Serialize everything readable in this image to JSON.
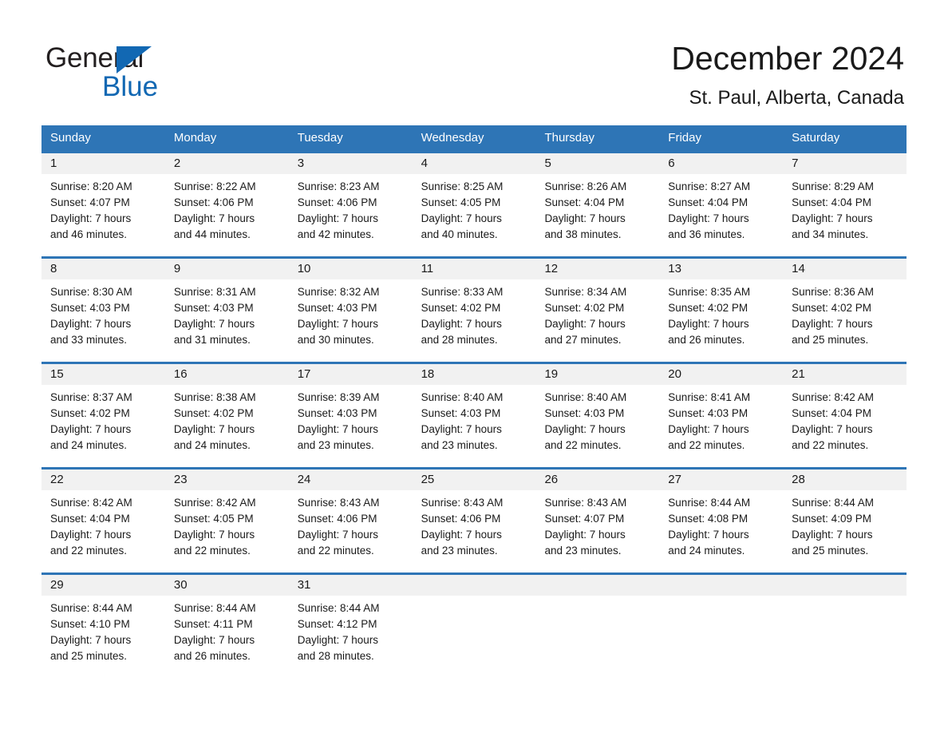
{
  "logo": {
    "word_one": "General",
    "word_two": "Blue",
    "triangle_icon": "triangle-icon",
    "brand_color": "#1268b3"
  },
  "header": {
    "title": "December 2024",
    "subtitle": "St. Paul, Alberta, Canada"
  },
  "theme": {
    "header_blue": "#2e75b6",
    "row_divider_blue": "#2e75b6",
    "date_band_gray": "#f1f1f1",
    "text_color": "#1a1a1a"
  },
  "weekdays": [
    "Sunday",
    "Monday",
    "Tuesday",
    "Wednesday",
    "Thursday",
    "Friday",
    "Saturday"
  ],
  "weeks": [
    {
      "days": [
        {
          "date": "1",
          "sunrise": "Sunrise: 8:20 AM",
          "sunset": "Sunset: 4:07 PM",
          "daylight_line1": "Daylight: 7 hours",
          "daylight_line2": "and 46 minutes."
        },
        {
          "date": "2",
          "sunrise": "Sunrise: 8:22 AM",
          "sunset": "Sunset: 4:06 PM",
          "daylight_line1": "Daylight: 7 hours",
          "daylight_line2": "and 44 minutes."
        },
        {
          "date": "3",
          "sunrise": "Sunrise: 8:23 AM",
          "sunset": "Sunset: 4:06 PM",
          "daylight_line1": "Daylight: 7 hours",
          "daylight_line2": "and 42 minutes."
        },
        {
          "date": "4",
          "sunrise": "Sunrise: 8:25 AM",
          "sunset": "Sunset: 4:05 PM",
          "daylight_line1": "Daylight: 7 hours",
          "daylight_line2": "and 40 minutes."
        },
        {
          "date": "5",
          "sunrise": "Sunrise: 8:26 AM",
          "sunset": "Sunset: 4:04 PM",
          "daylight_line1": "Daylight: 7 hours",
          "daylight_line2": "and 38 minutes."
        },
        {
          "date": "6",
          "sunrise": "Sunrise: 8:27 AM",
          "sunset": "Sunset: 4:04 PM",
          "daylight_line1": "Daylight: 7 hours",
          "daylight_line2": "and 36 minutes."
        },
        {
          "date": "7",
          "sunrise": "Sunrise: 8:29 AM",
          "sunset": "Sunset: 4:04 PM",
          "daylight_line1": "Daylight: 7 hours",
          "daylight_line2": "and 34 minutes."
        }
      ]
    },
    {
      "days": [
        {
          "date": "8",
          "sunrise": "Sunrise: 8:30 AM",
          "sunset": "Sunset: 4:03 PM",
          "daylight_line1": "Daylight: 7 hours",
          "daylight_line2": "and 33 minutes."
        },
        {
          "date": "9",
          "sunrise": "Sunrise: 8:31 AM",
          "sunset": "Sunset: 4:03 PM",
          "daylight_line1": "Daylight: 7 hours",
          "daylight_line2": "and 31 minutes."
        },
        {
          "date": "10",
          "sunrise": "Sunrise: 8:32 AM",
          "sunset": "Sunset: 4:03 PM",
          "daylight_line1": "Daylight: 7 hours",
          "daylight_line2": "and 30 minutes."
        },
        {
          "date": "11",
          "sunrise": "Sunrise: 8:33 AM",
          "sunset": "Sunset: 4:02 PM",
          "daylight_line1": "Daylight: 7 hours",
          "daylight_line2": "and 28 minutes."
        },
        {
          "date": "12",
          "sunrise": "Sunrise: 8:34 AM",
          "sunset": "Sunset: 4:02 PM",
          "daylight_line1": "Daylight: 7 hours",
          "daylight_line2": "and 27 minutes."
        },
        {
          "date": "13",
          "sunrise": "Sunrise: 8:35 AM",
          "sunset": "Sunset: 4:02 PM",
          "daylight_line1": "Daylight: 7 hours",
          "daylight_line2": "and 26 minutes."
        },
        {
          "date": "14",
          "sunrise": "Sunrise: 8:36 AM",
          "sunset": "Sunset: 4:02 PM",
          "daylight_line1": "Daylight: 7 hours",
          "daylight_line2": "and 25 minutes."
        }
      ]
    },
    {
      "days": [
        {
          "date": "15",
          "sunrise": "Sunrise: 8:37 AM",
          "sunset": "Sunset: 4:02 PM",
          "daylight_line1": "Daylight: 7 hours",
          "daylight_line2": "and 24 minutes."
        },
        {
          "date": "16",
          "sunrise": "Sunrise: 8:38 AM",
          "sunset": "Sunset: 4:02 PM",
          "daylight_line1": "Daylight: 7 hours",
          "daylight_line2": "and 24 minutes."
        },
        {
          "date": "17",
          "sunrise": "Sunrise: 8:39 AM",
          "sunset": "Sunset: 4:03 PM",
          "daylight_line1": "Daylight: 7 hours",
          "daylight_line2": "and 23 minutes."
        },
        {
          "date": "18",
          "sunrise": "Sunrise: 8:40 AM",
          "sunset": "Sunset: 4:03 PM",
          "daylight_line1": "Daylight: 7 hours",
          "daylight_line2": "and 23 minutes."
        },
        {
          "date": "19",
          "sunrise": "Sunrise: 8:40 AM",
          "sunset": "Sunset: 4:03 PM",
          "daylight_line1": "Daylight: 7 hours",
          "daylight_line2": "and 22 minutes."
        },
        {
          "date": "20",
          "sunrise": "Sunrise: 8:41 AM",
          "sunset": "Sunset: 4:03 PM",
          "daylight_line1": "Daylight: 7 hours",
          "daylight_line2": "and 22 minutes."
        },
        {
          "date": "21",
          "sunrise": "Sunrise: 8:42 AM",
          "sunset": "Sunset: 4:04 PM",
          "daylight_line1": "Daylight: 7 hours",
          "daylight_line2": "and 22 minutes."
        }
      ]
    },
    {
      "days": [
        {
          "date": "22",
          "sunrise": "Sunrise: 8:42 AM",
          "sunset": "Sunset: 4:04 PM",
          "daylight_line1": "Daylight: 7 hours",
          "daylight_line2": "and 22 minutes."
        },
        {
          "date": "23",
          "sunrise": "Sunrise: 8:42 AM",
          "sunset": "Sunset: 4:05 PM",
          "daylight_line1": "Daylight: 7 hours",
          "daylight_line2": "and 22 minutes."
        },
        {
          "date": "24",
          "sunrise": "Sunrise: 8:43 AM",
          "sunset": "Sunset: 4:06 PM",
          "daylight_line1": "Daylight: 7 hours",
          "daylight_line2": "and 22 minutes."
        },
        {
          "date": "25",
          "sunrise": "Sunrise: 8:43 AM",
          "sunset": "Sunset: 4:06 PM",
          "daylight_line1": "Daylight: 7 hours",
          "daylight_line2": "and 23 minutes."
        },
        {
          "date": "26",
          "sunrise": "Sunrise: 8:43 AM",
          "sunset": "Sunset: 4:07 PM",
          "daylight_line1": "Daylight: 7 hours",
          "daylight_line2": "and 23 minutes."
        },
        {
          "date": "27",
          "sunrise": "Sunrise: 8:44 AM",
          "sunset": "Sunset: 4:08 PM",
          "daylight_line1": "Daylight: 7 hours",
          "daylight_line2": "and 24 minutes."
        },
        {
          "date": "28",
          "sunrise": "Sunrise: 8:44 AM",
          "sunset": "Sunset: 4:09 PM",
          "daylight_line1": "Daylight: 7 hours",
          "daylight_line2": "and 25 minutes."
        }
      ]
    },
    {
      "days": [
        {
          "date": "29",
          "sunrise": "Sunrise: 8:44 AM",
          "sunset": "Sunset: 4:10 PM",
          "daylight_line1": "Daylight: 7 hours",
          "daylight_line2": "and 25 minutes."
        },
        {
          "date": "30",
          "sunrise": "Sunrise: 8:44 AM",
          "sunset": "Sunset: 4:11 PM",
          "daylight_line1": "Daylight: 7 hours",
          "daylight_line2": "and 26 minutes."
        },
        {
          "date": "31",
          "sunrise": "Sunrise: 8:44 AM",
          "sunset": "Sunset: 4:12 PM",
          "daylight_line1": "Daylight: 7 hours",
          "daylight_line2": "and 28 minutes."
        },
        {
          "date": "",
          "sunrise": "",
          "sunset": "",
          "daylight_line1": "",
          "daylight_line2": ""
        },
        {
          "date": "",
          "sunrise": "",
          "sunset": "",
          "daylight_line1": "",
          "daylight_line2": ""
        },
        {
          "date": "",
          "sunrise": "",
          "sunset": "",
          "daylight_line1": "",
          "daylight_line2": ""
        },
        {
          "date": "",
          "sunrise": "",
          "sunset": "",
          "daylight_line1": "",
          "daylight_line2": ""
        }
      ]
    }
  ]
}
